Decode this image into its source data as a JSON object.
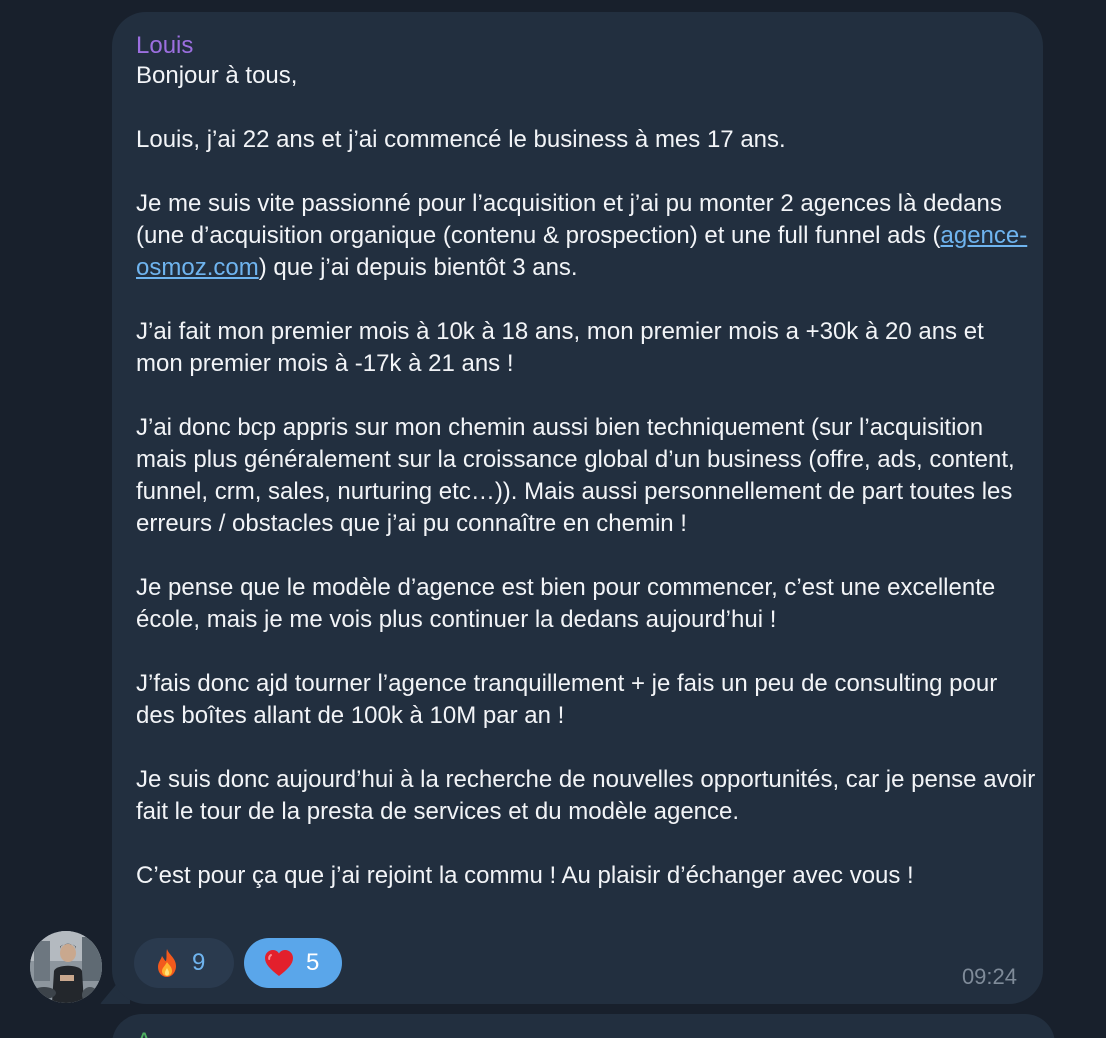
{
  "message": {
    "sender": "Louis",
    "paragraphs": [
      [
        "Bonjour à tous,"
      ],
      [
        "Louis, j’ai 22 ans et j’ai commencé le business à mes 17 ans."
      ],
      [
        "Je me suis vite passionné pour l’acquisition et j’ai pu monter 2 agences là dedans (une d’acquisition organique (contenu & prospection) et une full funnel ads (",
        "agence-osmoz.com",
        ") que j’ai depuis bientôt 3 ans."
      ],
      [
        "J’ai fait mon premier mois à 10k à 18 ans, mon premier mois a +30k à 20 ans et mon premier mois à -17k à 21 ans !"
      ],
      [
        "J’ai donc bcp appris sur mon chemin aussi bien techniquement (sur l’acquisition mais plus généralement sur la croissance global d’un business (offre, ads, content, funnel, crm, sales, nurturing etc…)). Mais aussi personnellement de part toutes les erreurs / obstacles que j’ai pu connaître en chemin !"
      ],
      [
        "Je pense que le modèle d’agence est bien pour commencer, c’est une excellente école,  mais je me vois plus continuer la dedans aujourd’hui !"
      ],
      [
        "J’fais donc ajd tourner l’agence tranquillement + je fais un peu de consulting pour des boîtes allant de 100k à 10M par an !"
      ],
      [
        "Je suis donc aujourd’hui à la recherche de nouvelles opportunités, car je pense avoir fait le tour de la presta de services et du modèle agence."
      ],
      [
        "C’est pour ça que j’ai rejoint la commu ! Au plaisir d’échanger avec vous !"
      ]
    ],
    "time": "09:24",
    "reactions": [
      {
        "emoji": "fire-icon",
        "count": "9",
        "selected": false
      },
      {
        "emoji": "heart-icon",
        "count": "5",
        "selected": true
      }
    ]
  },
  "next_message": {
    "sender": "A"
  },
  "colors": {
    "background": "#18202c",
    "bubble": "#222f3f",
    "sender_name": "#9c6fe0",
    "link": "#6fb4ef",
    "reaction_selected": "#5aa6ea",
    "next_sender_name": "#4fb061"
  }
}
